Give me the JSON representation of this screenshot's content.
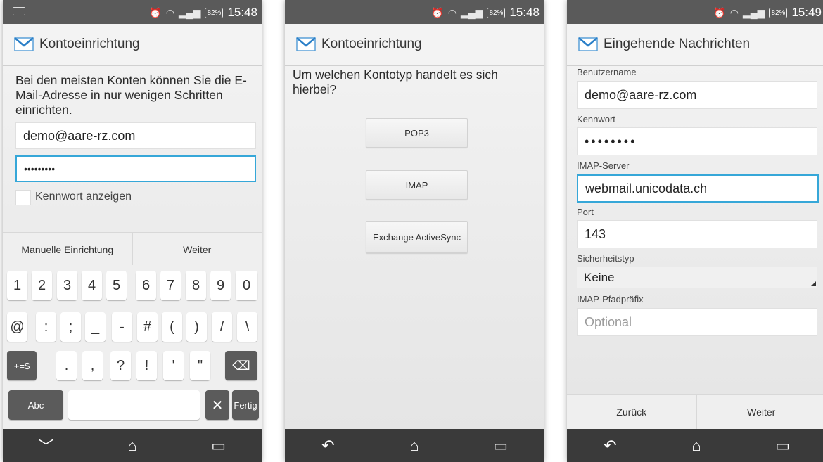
{
  "status": {
    "battery": "82%",
    "time1": "15:48",
    "time2": "15:48",
    "time3": "15:49"
  },
  "screen1": {
    "title": "Kontoeinrichtung",
    "intro": "Bei den meisten Konten können Sie die E-Mail-Adresse in nur wenigen Schritten einrichten.",
    "email_value": "demo@aare-rz.com",
    "password_value": "•••••••••",
    "show_password_label": "Kennwort anzeigen",
    "manual_label": "Manuelle Einrichtung",
    "next_label": "Weiter",
    "keyboard": {
      "row1": [
        "1",
        "2",
        "3",
        "4",
        "5",
        "6",
        "7",
        "8",
        "9",
        "0"
      ],
      "row2": [
        "@",
        ":",
        ";",
        "_",
        "-",
        "#",
        "(",
        ")",
        "/",
        "\\"
      ],
      "row3": [
        "+=$",
        ".",
        ",",
        "?",
        "!",
        "'",
        "\""
      ],
      "abc_label": "Abc",
      "done_label": "Fertig"
    }
  },
  "screen2": {
    "title": "Kontoeinrichtung",
    "question": "Um welchen Kontotyp handelt es sich hierbei?",
    "buttons": [
      "POP3",
      "IMAP",
      "Exchange ActiveSync"
    ]
  },
  "screen3": {
    "title": "Eingehende Nachrichten",
    "username_label": "Benutzername",
    "username_value": "demo@aare-rz.com",
    "password_label": "Kennwort",
    "password_value": "••••••••",
    "server_label": "IMAP-Server",
    "server_value": "webmail.unicodata.ch",
    "port_label": "Port",
    "port_value": "143",
    "security_label": "Sicherheitstyp",
    "security_value": "Keine",
    "prefix_label": "IMAP-Pfadpräfix",
    "prefix_placeholder": "Optional",
    "back_label": "Zurück",
    "next_label": "Weiter"
  }
}
